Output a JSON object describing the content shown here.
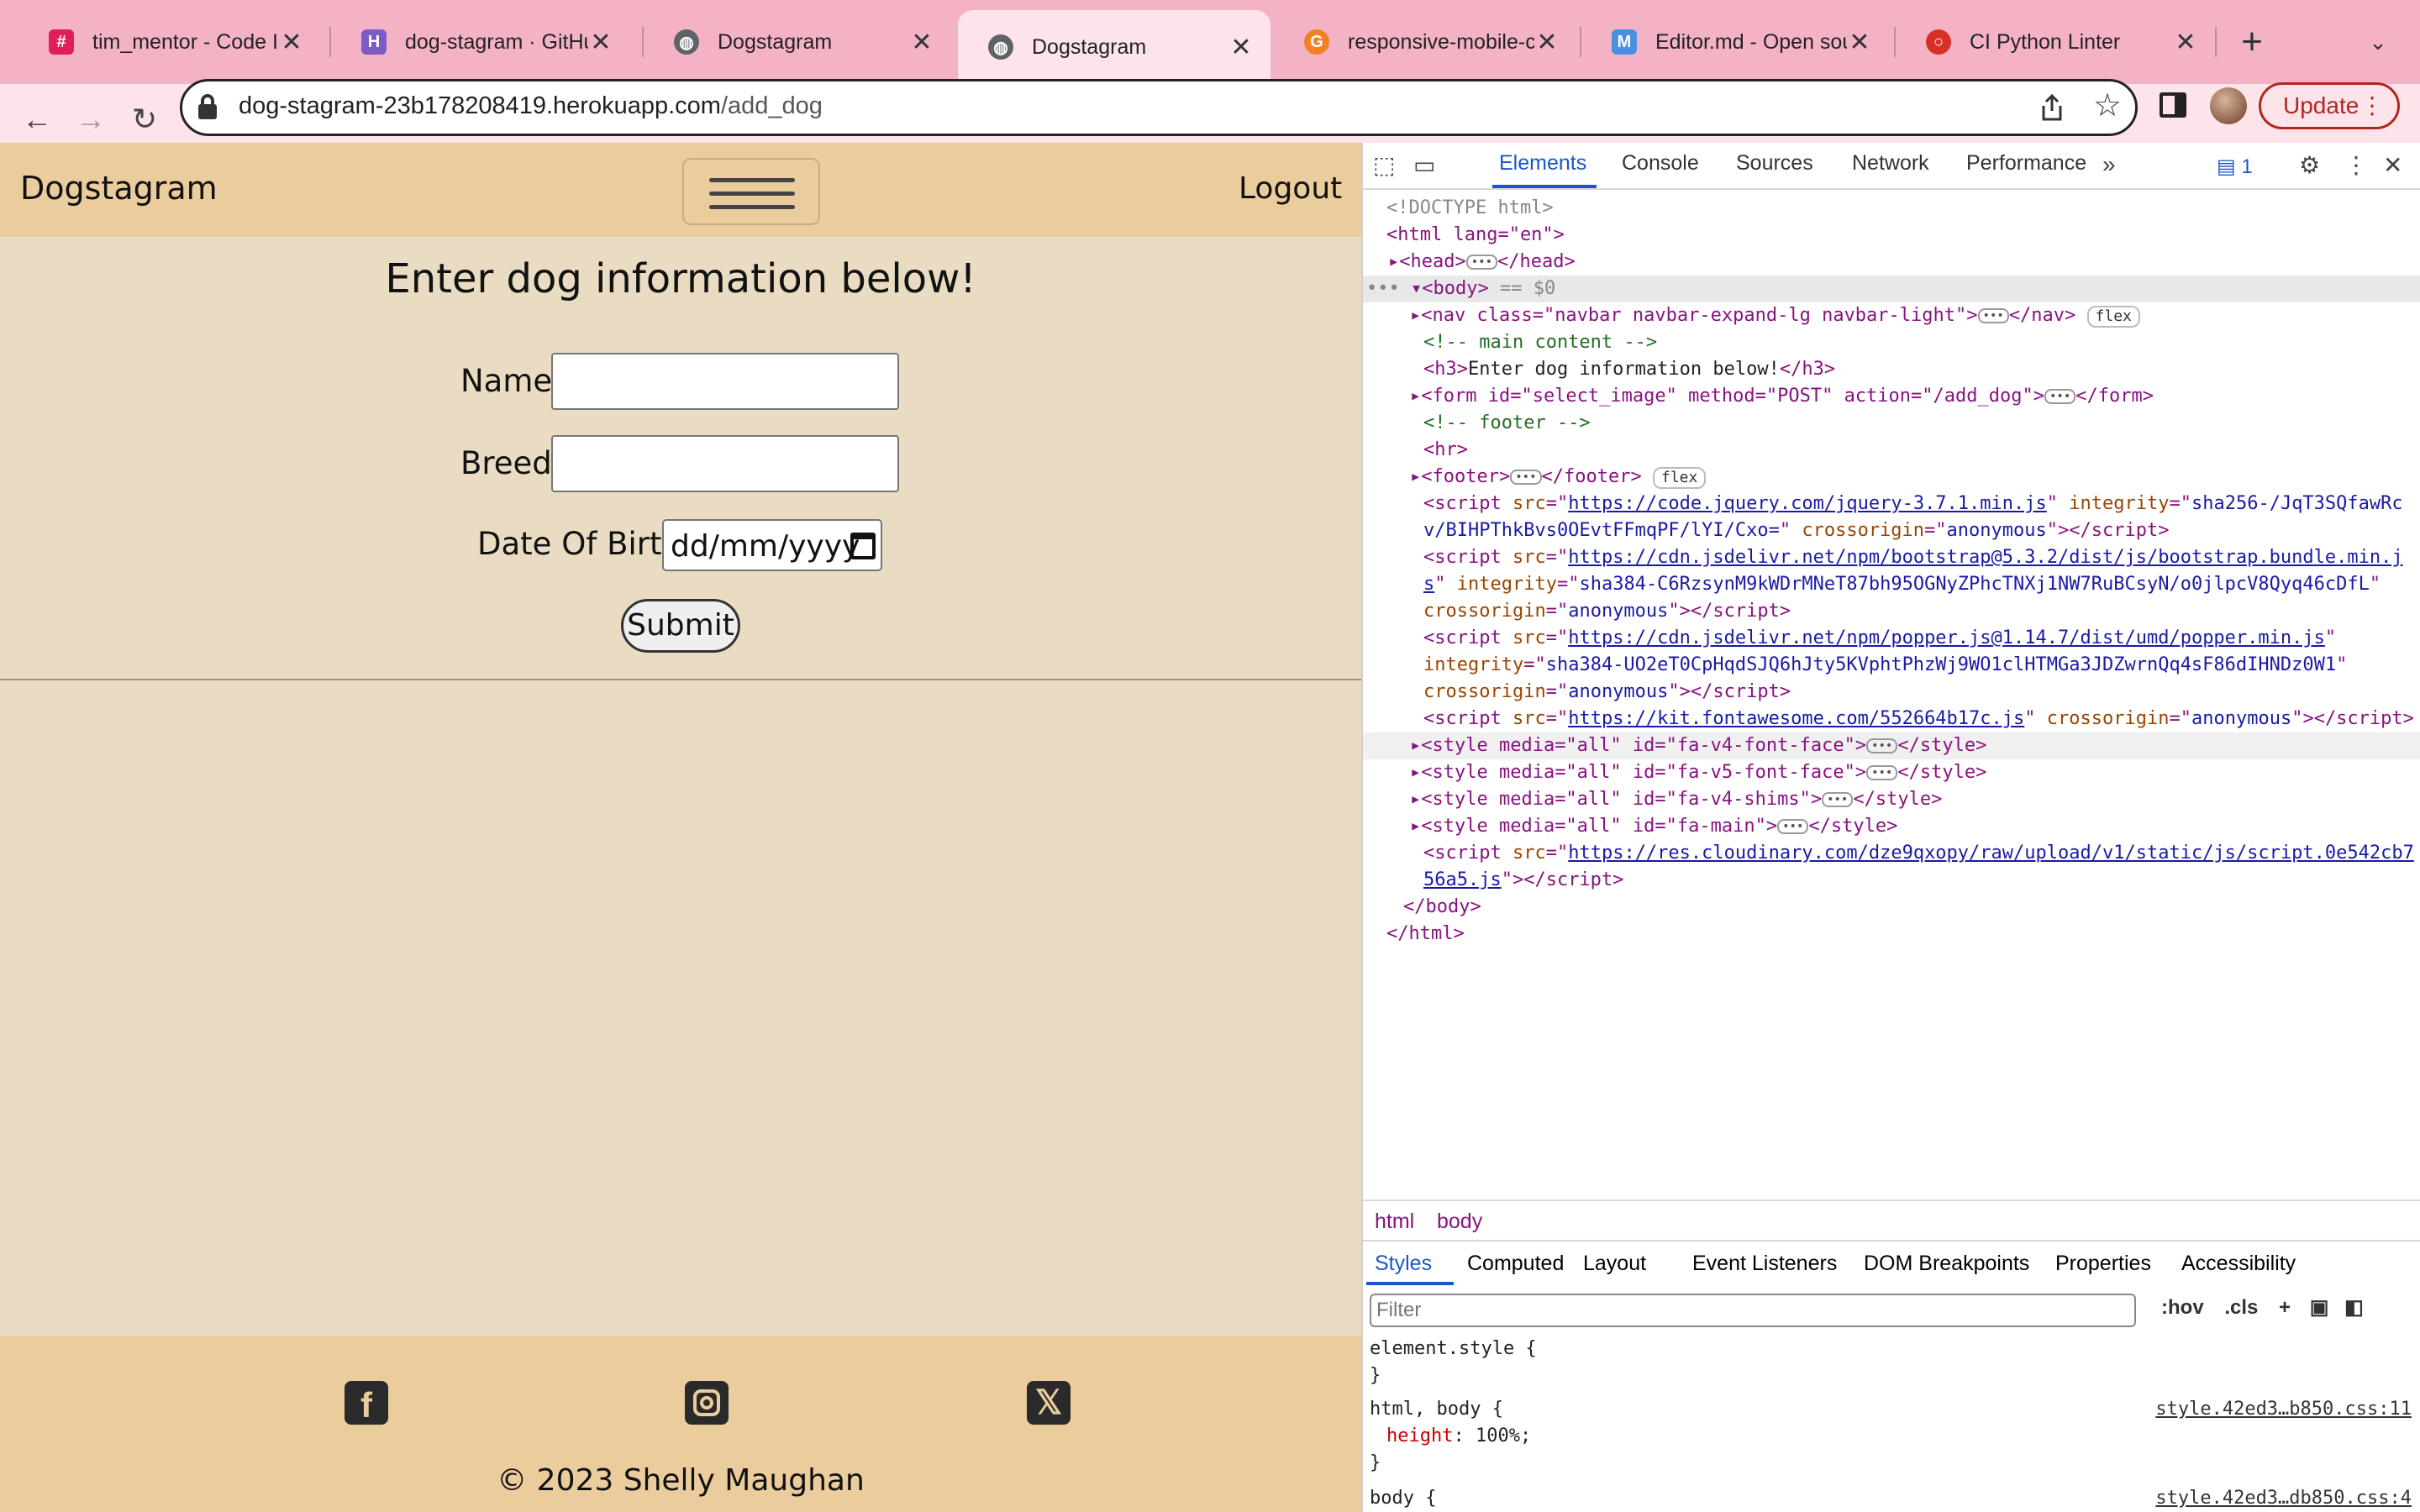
{
  "browser": {
    "tabs": [
      {
        "title": "tim_mentor - Code In",
        "active": false
      },
      {
        "title": "dog-stagram · GitHu",
        "active": false
      },
      {
        "title": "Dogstagram",
        "active": false
      },
      {
        "title": "Dogstagram",
        "active": true
      },
      {
        "title": "responsive-mobile-c",
        "active": false
      },
      {
        "title": "Editor.md - Open sou",
        "active": false
      },
      {
        "title": "CI Python Linter",
        "active": false
      }
    ],
    "close_glyph": "✕",
    "new_tab_glyph": "+",
    "tab_list_glyph": "⌄",
    "url_host": "dog-stagram-23b178208419.herokuapp.com",
    "url_path": "/add_dog",
    "update_label": "Update",
    "favicon_colors": [
      "#e01e5a",
      "#7c5cc4",
      "#5f6368",
      "#5f6368",
      "#f48024",
      "#4a90e2",
      "#d93025"
    ]
  },
  "page": {
    "brand": "Dogstagram",
    "logout": "Logout",
    "heading": "Enter dog information below!",
    "form": {
      "name_label": "Name:",
      "breed_label": "Breed:",
      "dob_label": "Date Of Birth:",
      "dob_placeholder": "dd/mm/yyyy",
      "submit_label": "Submit"
    },
    "footer": {
      "copyright": "© 2023 Shelly Maughan",
      "social_icons": [
        "facebook-icon",
        "instagram-icon",
        "x-icon"
      ]
    },
    "colors": {
      "nav_bg": "#ebcc9d",
      "page_bg": "#e9dcc2"
    }
  },
  "devtools": {
    "tabs": [
      "Elements",
      "Console",
      "Sources",
      "Network",
      "Performance"
    ],
    "more": "»",
    "issues_count": "1",
    "tree": {
      "doctype": "<!DOCTYPE html>",
      "html_open": "<html lang=\"en\">",
      "head": "<head>",
      "head_close": "</head>",
      "body_open": "<body>",
      "body_marker": "== $0",
      "nav_tag": "<nav class=\"navbar navbar-expand-lg navbar-light\">",
      "nav_close": "</nav>",
      "flex": "flex",
      "comment_main": "<!-- main content -->",
      "h3_text": "Enter dog information below!",
      "form_tag": "<form id=\"select_image\" method=\"POST\" action=\"/add_dog\">",
      "form_close": "</form>",
      "comment_footer": "<!-- footer -->",
      "hr": "<hr>",
      "footer_tag": "<footer>",
      "footer_close": "</footer>",
      "script_jquery_src": "https://code.jquery.com/jquery-3.7.1.min.js",
      "script_jquery_integrity": "sha256-/JqT3SQfawRc",
      "script_jquery_integrity_2": "v/BIHPThkBvs0OEvtFFmqPF/lYI/Cxo=",
      "script_bootstrap_src": "https://cdn.jsdelivr.net/npm/bootstrap@5.3.2/dist/js/bootstrap.bundle.min.j",
      "script_bootstrap_src_2": "s",
      "script_bootstrap_integrity": "sha384-C6RzsynM9kWDrMNeT87bh95OGNyZPhcTNXj1NW7RuBCsyN/o0jlpcV8Qyq46cDfL",
      "script_popper_src": "https://cdn.jsdelivr.net/npm/popper.js@1.14.7/dist/umd/popper.min.js",
      "script_popper_integrity": "sha384-UO2eT0CpHqdSJQ6hJty5KVphtPhzWj9WO1clHTMGa3JDZwrnQq4sF86dIHNDz0W1",
      "script_fa_src": "https://kit.fontawesome.com/552664b17c.js",
      "crossorigin": "anonymous",
      "styles": [
        "<style media=\"all\" id=\"fa-v4-font-face\">",
        "<style media=\"all\" id=\"fa-v5-font-face\">",
        "<style media=\"all\" id=\"fa-v4-shims\">",
        "<style media=\"all\" id=\"fa-main\">"
      ],
      "style_close": "</style>",
      "script_cloudinary_src": "https://res.cloudinary.com/dze9qxopy/raw/upload/v1/static/js/script.0e542cb7",
      "script_cloudinary_src_2": "56a5.js",
      "body_close": "</body>",
      "html_close": "</html>"
    },
    "breadcrumbs": [
      "html",
      "body"
    ],
    "style_tabs": [
      "Styles",
      "Computed",
      "Layout",
      "Event Listeners",
      "DOM Breakpoints",
      "Properties",
      "Accessibility"
    ],
    "filter_placeholder": "Filter",
    "hov": ":hov",
    "cls": ".cls",
    "rules": [
      {
        "selector": "element.style {",
        "close": "}"
      },
      {
        "selector": "html, body {",
        "prop": "height",
        "value": "100%;",
        "close": "}",
        "source": "style.42ed3…b850.css:11"
      },
      {
        "selector": "body {",
        "source": "style.42ed3…db850.css:4"
      }
    ]
  }
}
